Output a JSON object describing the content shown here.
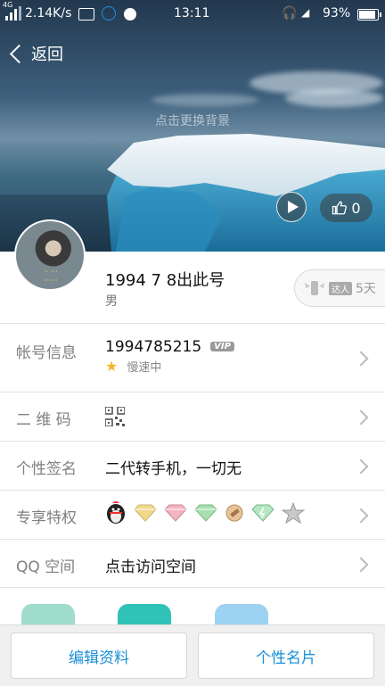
{
  "status_bar": {
    "network_type": "4G",
    "speed": "2.14K/s",
    "time": "13:11",
    "battery": "93%"
  },
  "header": {
    "back_label": "返回",
    "change_bg_hint": "点击更换背景",
    "likes_count": "0"
  },
  "profile": {
    "nickname": "1994 7 8出此号",
    "gender": "男",
    "daren_tag": "达人",
    "daren_days": "5天"
  },
  "rows": {
    "account": {
      "label": "帐号信息",
      "value": "1994785215",
      "vip": "VIP",
      "status": "慢速中"
    },
    "qrcode": {
      "label": "二 维 码"
    },
    "signature": {
      "label": "个性签名",
      "value": "二代转手机，一切无"
    },
    "privileges": {
      "label": "专享特权"
    },
    "qzone": {
      "label": "QQ 空间",
      "value": "点击访问空间"
    }
  },
  "bottom": {
    "edit_label": "编辑资料",
    "card_label": "个性名片"
  },
  "colors": {
    "accent": "#1a8fd8",
    "label": "#808080",
    "app_green": "#5ccfa8",
    "app_teal": "#2ec3b6",
    "app_blue": "#7cc4f0"
  }
}
